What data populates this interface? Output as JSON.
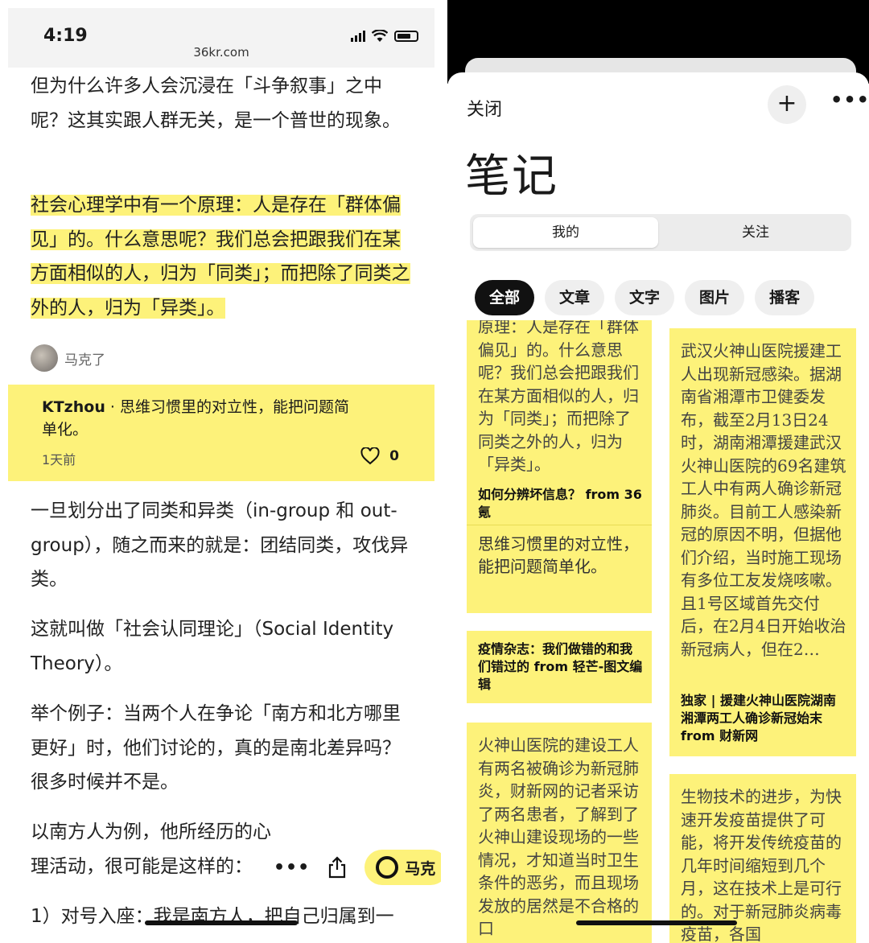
{
  "left": {
    "status": {
      "time": "4:19",
      "url": "36kr.com"
    },
    "p1": "但为什么许多人会沉浸在「斗争叙事」之中呢？这其实跟人群无关，是一个普世的现象。",
    "p2": "社会心理学中有一个原理：人是存在「群体偏见」的。什么意思呢？我们总会把跟我们在某方面相似的人，归为「同类」；而把除了同类之外的人，归为「异类」。",
    "highlighter": "马克了",
    "comment": {
      "user": "KTzhou",
      "separator": " · ",
      "text": "思维习惯里的对立性，能把问题简单化。",
      "time": "1天前",
      "likes": "0"
    },
    "p3": "一旦划分出了同类和异类（in-group 和 out-group），随之而来的就是：团结同类，攻伐异类。",
    "p4": "这就叫做「社会认同理论」（Social Identity Theory）。",
    "p5": "举个例子：当两个人在争论「南方和北方哪里更好」时，他们讨论的，真的是南北差异吗？很多时候并不是。",
    "p6": "以南方人为例，他所经历的心理活动，很可能是这样的：",
    "p7": "1）对号入座：我是南方人，把自己归属到一",
    "toolbar": {
      "more": "•••",
      "mark_label": "马克"
    }
  },
  "right": {
    "close": "关闭",
    "plus": "+",
    "more": "•••",
    "title": "笔记",
    "segments": [
      "我的",
      "关注"
    ],
    "chips": [
      "全部",
      "文章",
      "文字",
      "图片",
      "播客"
    ],
    "cards": {
      "c1_body": "原理：人是存在「群体偏见」的。什么意思呢？我们总会把跟我们在某方面相似的人，归为「同类」；而把除了同类之外的人，归为「异类」。",
      "c1_src": "如何分辨坏信息？ from 36 氪",
      "c1_note": "思维习惯里的对立性，能把问题简单化。",
      "c2_src": "疫情杂志：我们做错的和我们错过的 from 轻芒-图文编辑",
      "c3_body": "火神山医院的建设工人有两名被确诊为新冠肺炎，财新网的记者采访了两名患者，了解到了火神山建设现场的一些情况，才知道当时卫生条件的恶劣，而且现场发放的居然是不合格的口",
      "c4_body": "武汉火神山医院援建工人出现新冠感染。据湖南省湘潭市卫健委发布，截至2月13日24时，湖南湘潭援建武汉火神山医院的69名建筑工人中有两人确诊新冠肺炎。目前工人感染新冠的原因不明，但据他们介绍，当时施工现场有多位工友发烧咳嗽。且1号区域首先交付后，在2月4日开始收治新冠病人，但在2…",
      "c4_src": "独家 | 援建火神山医院湖南湘潭两工人确诊新冠始末 from 财新网",
      "c5_body": "生物技术的进步，为快速开发疫苗提供了可能，将开发传统疫苗的几年时间缩短到几个月，这在技术上是可行的。对于新冠肺炎病毒疫苗，各国"
    }
  },
  "colors": {
    "highlight": "#fdf27a",
    "ink": "#1a1a1a"
  }
}
